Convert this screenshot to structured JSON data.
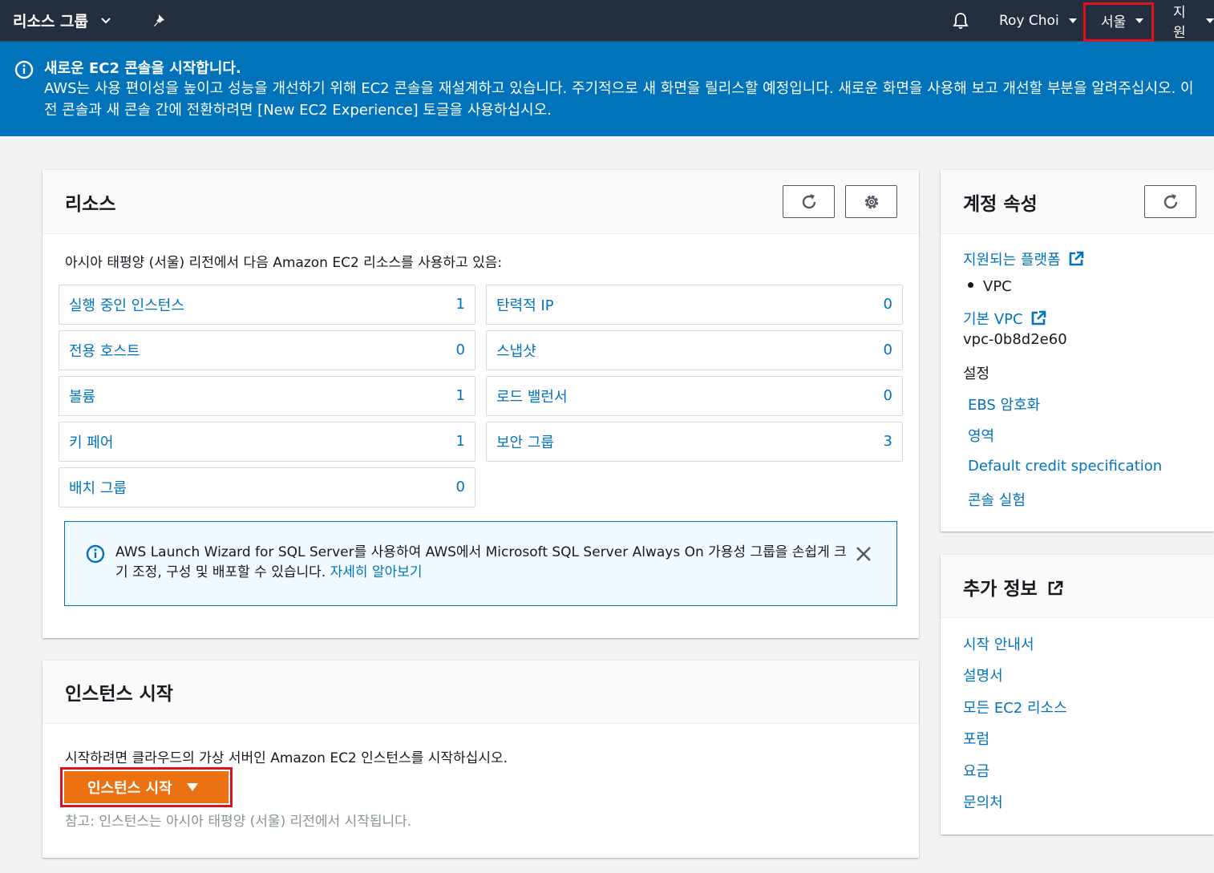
{
  "nav": {
    "title": "리소스 그룹",
    "user": "Roy Choi",
    "region": "서울",
    "support": "지원"
  },
  "banner": {
    "title": "새로운 EC2 콘솔을 시작합니다.",
    "body": "AWS는 사용 편이성을 높이고 성능을 개선하기 위해 EC2 콘솔을 재설계하고 있습니다. 주기적으로 새 화면을 릴리스할 예정입니다. 새로운 화면을 사용해 보고 개선할 부분을 알려주십시오. 이전 콘솔과 새 콘솔 간에 전환하려면 [New EC2 Experience] 토글을 사용하십시오."
  },
  "resources": {
    "title": "리소스",
    "intro": "아시아 태평양 (서울) 리전에서 다음 Amazon EC2 리소스를 사용하고 있음:",
    "items": [
      {
        "label": "실행 중인 인스턴스",
        "value": "1"
      },
      {
        "label": "탄력적 IP",
        "value": "0"
      },
      {
        "label": "전용 호스트",
        "value": "0"
      },
      {
        "label": "스냅샷",
        "value": "0"
      },
      {
        "label": "볼륨",
        "value": "1"
      },
      {
        "label": "로드 밸런서",
        "value": "0"
      },
      {
        "label": "키 페어",
        "value": "1"
      },
      {
        "label": "보안 그룹",
        "value": "3"
      },
      {
        "label": "배치 그룹",
        "value": "0"
      }
    ],
    "alert_text": "AWS Launch Wizard for SQL Server를 사용하여 AWS에서 Microsoft SQL Server Always On 가용성 그룹을 손쉽게 크기 조정, 구성 및 배포할 수 있습니다.",
    "alert_link": "자세히 알아보기"
  },
  "launch": {
    "title": "인스턴스 시작",
    "intro": "시작하려면 클라우드의 가상 서버인 Amazon EC2 인스턴스를 시작하십시오.",
    "button": "인스턴스 시작",
    "note": "참고: 인스턴스는 아시아 태평양 (서울) 리전에서 시작됩니다."
  },
  "account": {
    "title": "계정 속성",
    "platforms_link": "지원되는 플랫폼",
    "platform_item": "VPC",
    "default_vpc_link": "기본 VPC",
    "vpc_id": "vpc-0b8d2e60",
    "settings_label": "설정",
    "settings_links": [
      "EBS 암호화",
      "영역",
      "Default credit specification",
      "콘솔 실험"
    ]
  },
  "more": {
    "title": "추가 정보",
    "links": [
      "시작 안내서",
      "설명서",
      "모든 EC2 리소스",
      "포럼",
      "요금",
      "문의처"
    ]
  }
}
